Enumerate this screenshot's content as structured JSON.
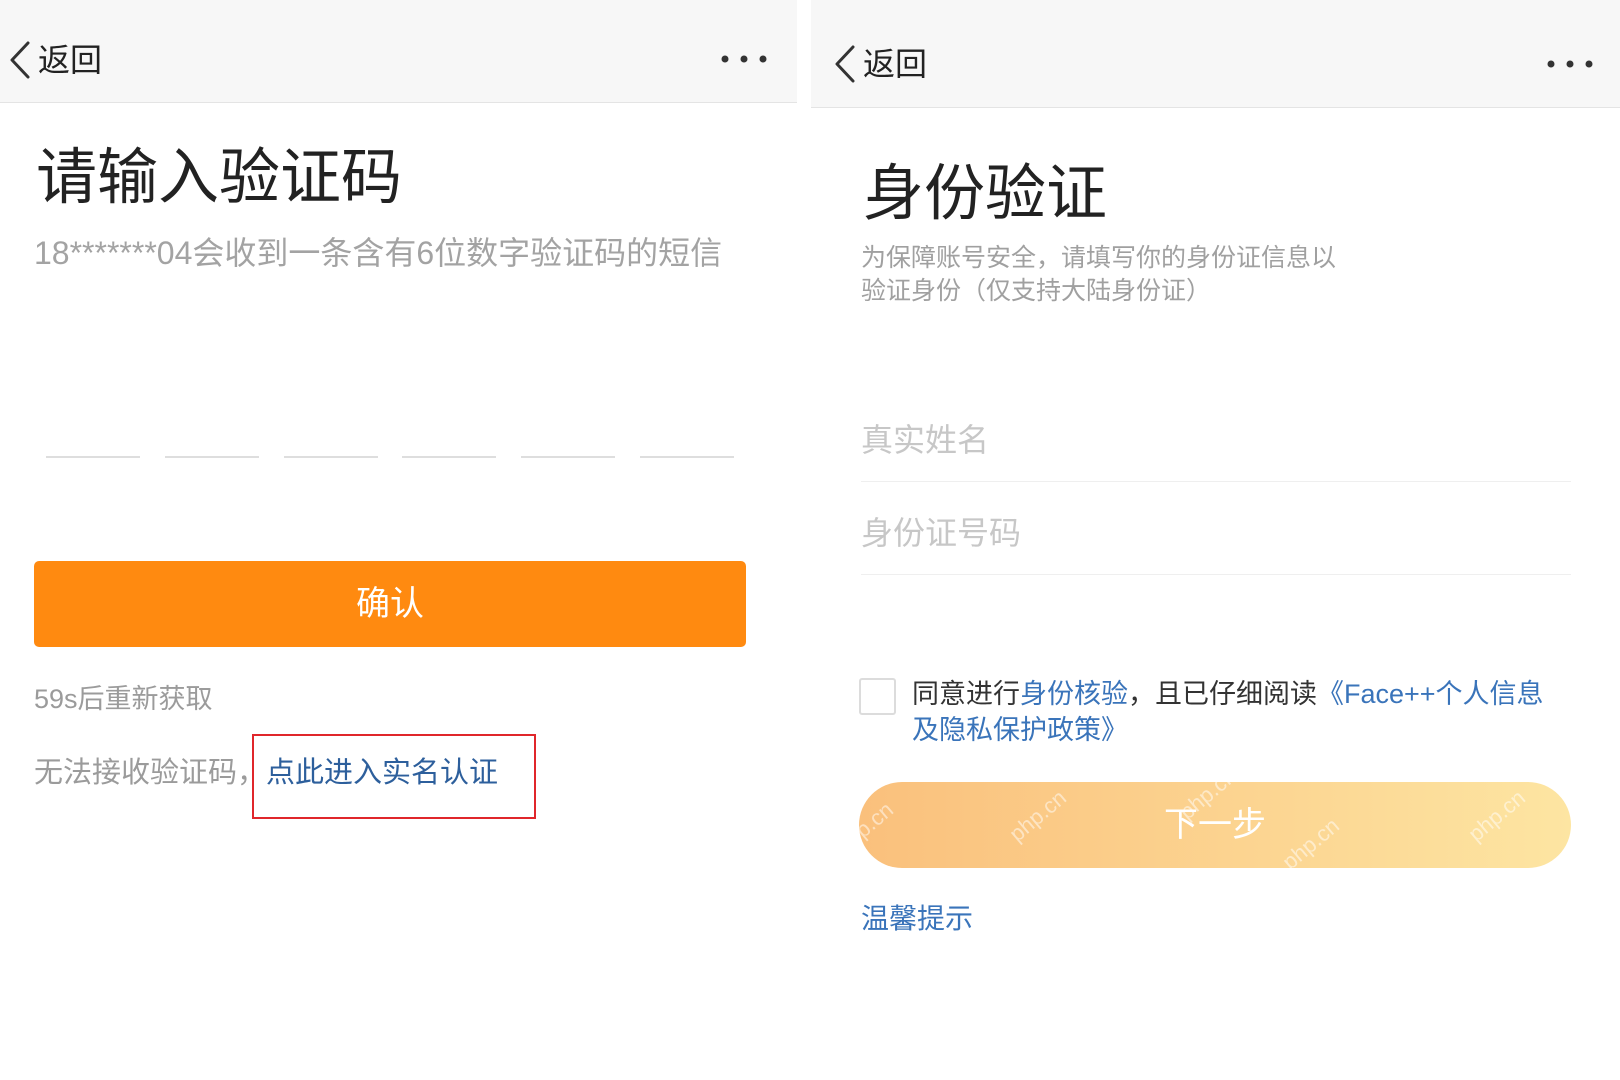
{
  "colors": {
    "accent_orange": "#ff8a10",
    "link_blue_dark": "#2d5f9c",
    "link_blue": "#3a74ba",
    "highlight_red": "#e0262b",
    "next_button_gradient": [
      "#fac07c",
      "#fde5a2"
    ]
  },
  "icons": {
    "back": "chevron-left-icon",
    "more": "more-dots-icon",
    "checkbox": "checkbox-unchecked-icon"
  },
  "left_screen": {
    "nav": {
      "back_label": "返回"
    },
    "title": "请输入验证码",
    "subtitle": "18*******04会收到一条含有6位数字验证码的短信",
    "code_digits": [
      "",
      "",
      "",
      "",
      "",
      ""
    ],
    "confirm_button": "确认",
    "resend_countdown": "59s后重新获取",
    "cannot_receive_text": "无法接收验证码，",
    "real_name_link": "点此进入实名认证"
  },
  "right_screen": {
    "nav": {
      "back_label": "返回"
    },
    "title": "身份验证",
    "description": "为保障账号安全，请填写你的身份证信息以验证身份（仅支持大陆身份证）",
    "name_field": {
      "value": "",
      "placeholder": "真实姓名"
    },
    "id_field": {
      "value": "",
      "placeholder": "身份证号码"
    },
    "agreement": {
      "checked": false,
      "prefix": "同意进行",
      "verify_link": "身份核验",
      "middle": "，且已仔细阅读",
      "policy_link": "《Face++个人信息及隐私保护政策》"
    },
    "next_button": "下一步",
    "tips_link": "温馨提示",
    "watermark": "php.cn"
  }
}
